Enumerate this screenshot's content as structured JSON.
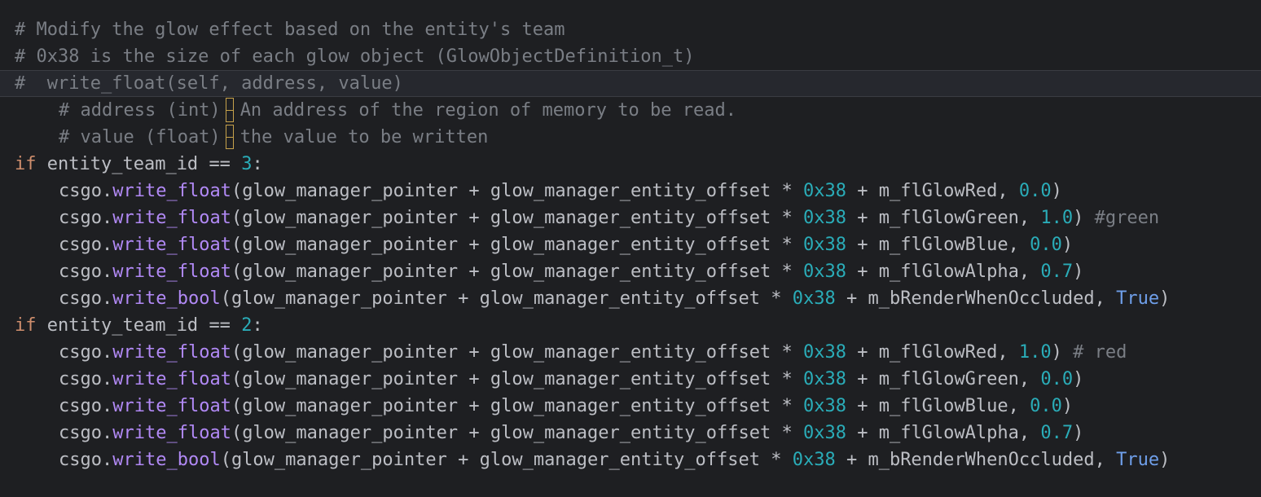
{
  "colors": {
    "background": "#1e1f22",
    "comment": "#7a7e85",
    "keyword": "#cf8e6d",
    "function": "#b189f5",
    "number": "#2aacb8",
    "true_keyword": "#6f9fea",
    "text": "#bcbec4",
    "hint_bar": "#c7a24b"
  },
  "comments": {
    "line1": "# Modify the glow effect based on the entity's team",
    "line2": "# 0x38 is the size of each glow object (GlowObjectDefinition_t)",
    "line3": "#  write_float(self, address, value)",
    "line4a": "# address (int)",
    "line4b": "An address of the region of memory to be read.",
    "line5a": "# value (float)",
    "line5b": "the value to be written"
  },
  "code": {
    "kw_if": "if",
    "cond_var": "entity_team_id",
    "eq": "==",
    "team_ct": "3",
    "team_t": "2",
    "colon": ":",
    "obj": "csgo",
    "dot": ".",
    "write_float": "write_float",
    "write_bool": "write_bool",
    "lparen": "(",
    "rparen": ")",
    "pointer": "glow_manager_pointer",
    "plus": "+",
    "offset_var": "glow_manager_entity_offset",
    "mul": "*",
    "size_hex": "0x38",
    "comma": ",",
    "field_red": "m_flGlowRed",
    "field_green": "m_flGlowGreen",
    "field_blue": "m_flGlowBlue",
    "field_alpha": "m_flGlowAlpha",
    "field_occluded": "m_bRenderWhenOccluded",
    "val_zero": "0.0",
    "val_one": "1.0",
    "val_alpha": "0.7",
    "val_true": "True",
    "comment_green": "#green",
    "comment_red": "# red"
  }
}
